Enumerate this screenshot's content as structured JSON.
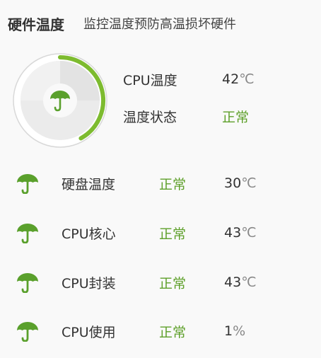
{
  "header": {
    "title": "硬件温度",
    "subtitle": "监控温度预防高温损坏硬件"
  },
  "gauge": {
    "icon": "umbrella-icon",
    "accent_color": "#7dbb2f",
    "track_color": "#e3e3e3",
    "level_fraction": 0.42
  },
  "cpu": {
    "temp_label": "CPU温度",
    "temp_value": "42",
    "temp_unit": "℃",
    "status_label": "温度状态",
    "status_value": "正常"
  },
  "sensors": [
    {
      "icon": "umbrella-icon",
      "name": "硬盘温度",
      "status": "正常",
      "value": "30",
      "unit": "℃"
    },
    {
      "icon": "umbrella-icon",
      "name": "CPU核心",
      "status": "正常",
      "value": "43",
      "unit": "℃"
    },
    {
      "icon": "umbrella-icon",
      "name": "CPU封装",
      "status": "正常",
      "value": "43",
      "unit": "℃"
    },
    {
      "icon": "umbrella-icon",
      "name": "CPU使用",
      "status": "正常",
      "value": "1",
      "unit": "%"
    }
  ],
  "colors": {
    "status_ok": "#5ea02a",
    "icon_green": "#5aa02c"
  }
}
